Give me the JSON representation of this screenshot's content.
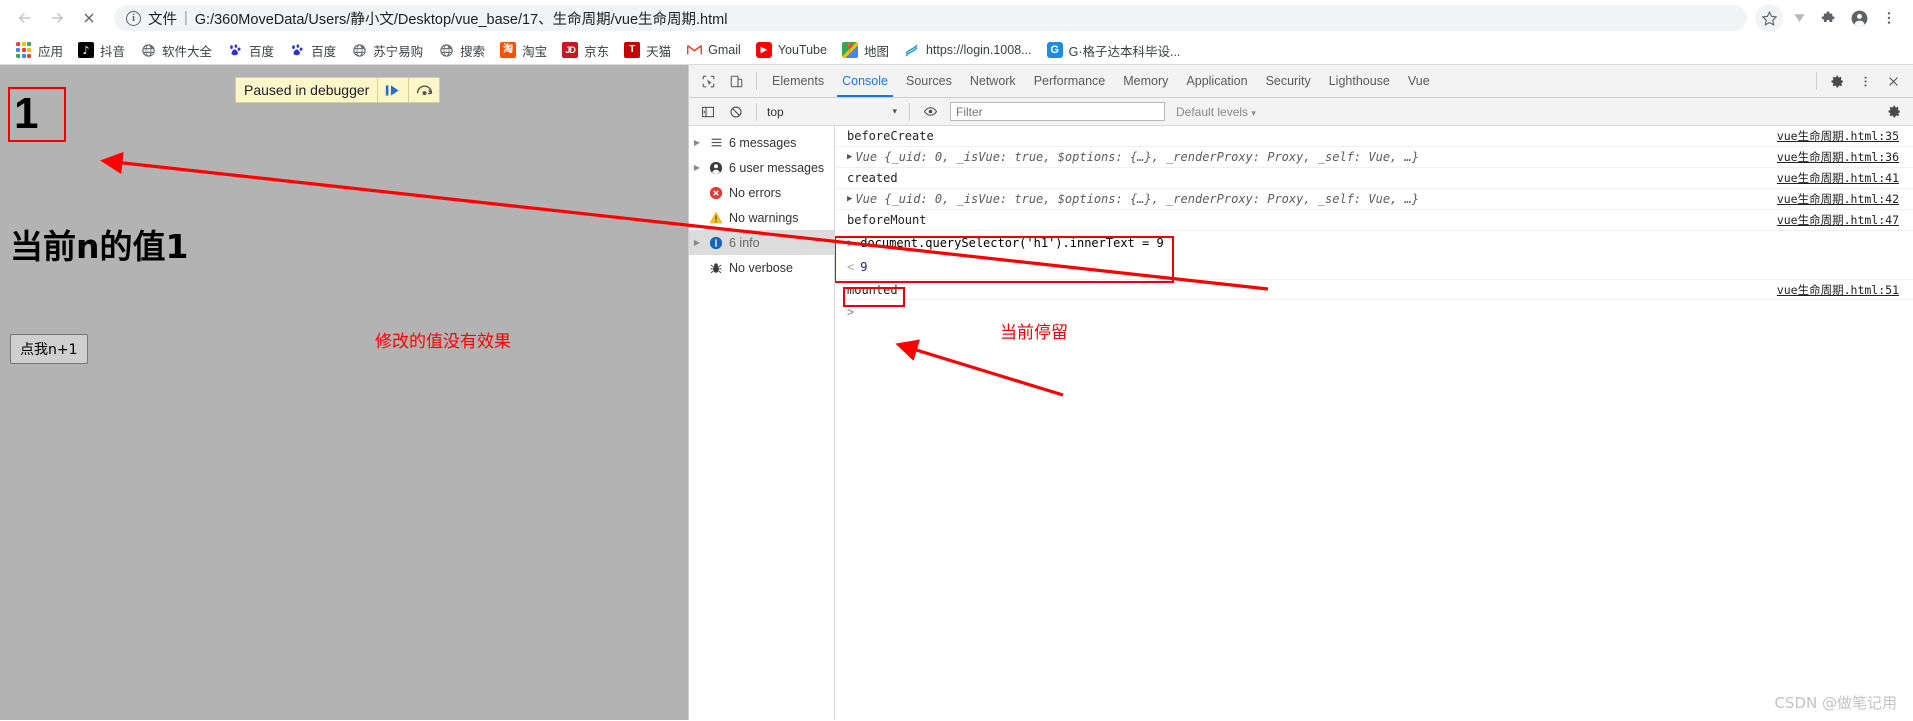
{
  "browser": {
    "nav": {
      "back_icon": "arrow-left-icon",
      "forward_icon": "arrow-right-icon",
      "stop_icon": "close-x-icon"
    },
    "omnibox": {
      "info_icon": "info-circle-icon",
      "scheme_label": "文件",
      "separator": "|",
      "url": "G:/360MoveData/Users/静小文/Desktop/vue_base/17、生命周期/vue生命周期.html"
    },
    "right_icons": [
      {
        "name": "bookmark-star-icon",
        "glyph": "☆"
      },
      {
        "name": "download-chevron-icon",
        "glyph": "▼"
      },
      {
        "name": "extensions-puzzle-icon",
        "glyph": "🧩"
      },
      {
        "name": "profile-avatar-icon",
        "glyph": "●"
      },
      {
        "name": "chrome-menu-icon",
        "glyph": "⋮"
      }
    ],
    "bookmarks": [
      {
        "label": "应用",
        "icon": "apps-grid-icon"
      },
      {
        "label": "抖音",
        "icon": "douyin-icon"
      },
      {
        "label": "软件大全",
        "icon": "globe-icon"
      },
      {
        "label": "百度",
        "icon": "baidu-paw-icon"
      },
      {
        "label": "百度",
        "icon": "baidu-paw-icon"
      },
      {
        "label": "苏宁易购",
        "icon": "globe-icon"
      },
      {
        "label": "搜索",
        "icon": "globe-icon"
      },
      {
        "label": "淘宝",
        "icon": "taobao-icon"
      },
      {
        "label": "京东",
        "icon": "jd-icon"
      },
      {
        "label": "天猫",
        "icon": "tmall-icon"
      },
      {
        "label": "Gmail",
        "icon": "gmail-icon"
      },
      {
        "label": "YouTube",
        "icon": "youtube-icon"
      },
      {
        "label": "地图",
        "icon": "google-maps-icon"
      },
      {
        "label": "https://login.1008...",
        "icon": "blue-swirl-icon"
      },
      {
        "label": "G·格子达本科毕设...",
        "icon": "gezida-icon"
      }
    ]
  },
  "page": {
    "paused_banner": {
      "text": "Paused in debugger",
      "resume_icon": "resume-script-icon",
      "step_icon": "step-over-icon"
    },
    "h1_value": "1",
    "h2_text": "当前n的值1",
    "button_label": "点我n+1",
    "annotation": "修改的值没有效果",
    "background_color": "#b3b3b3",
    "highlight_color": "#ee0000"
  },
  "devtools": {
    "left_icons": [
      {
        "name": "inspect-element-icon",
        "glyph": "⬚"
      },
      {
        "name": "device-toolbar-icon",
        "glyph": "▯"
      }
    ],
    "tabs": [
      {
        "label": "Elements",
        "active": false
      },
      {
        "label": "Console",
        "active": true
      },
      {
        "label": "Sources",
        "active": false
      },
      {
        "label": "Network",
        "active": false
      },
      {
        "label": "Performance",
        "active": false
      },
      {
        "label": "Memory",
        "active": false
      },
      {
        "label": "Application",
        "active": false
      },
      {
        "label": "Security",
        "active": false
      },
      {
        "label": "Lighthouse",
        "active": false
      },
      {
        "label": "Vue",
        "active": false
      }
    ],
    "right_icons": [
      {
        "name": "settings-gear-icon",
        "glyph": "⚙"
      },
      {
        "name": "devtools-menu-icon",
        "glyph": "⋮"
      },
      {
        "name": "devtools-close-icon",
        "glyph": "✕"
      }
    ],
    "filter_bar": {
      "sidebar_toggle_icon": "console-sidebar-toggle-icon",
      "clear_icon": "clear-console-icon",
      "context_value": "top",
      "context_caret": "▾",
      "eye_icon": "live-expression-eye-icon",
      "filter_placeholder": "Filter",
      "filter_value": "",
      "levels_label": "Default levels",
      "levels_caret": "▾",
      "settings_icon": "console-settings-gear-icon"
    },
    "sidebar": [
      {
        "label": "6 messages",
        "icon": "list-icon",
        "expandable": true,
        "selected": false
      },
      {
        "label": "6 user messages",
        "icon": "person-icon",
        "expandable": true,
        "selected": false
      },
      {
        "label": "No errors",
        "icon": "error-icon",
        "expandable": false,
        "selected": false
      },
      {
        "label": "No warnings",
        "icon": "warning-icon",
        "expandable": false,
        "selected": false
      },
      {
        "label": "6 info",
        "icon": "info-icon",
        "expandable": true,
        "selected": true
      },
      {
        "label": "No verbose",
        "icon": "bug-icon",
        "expandable": false,
        "selected": false
      }
    ],
    "messages": [
      {
        "type": "log",
        "text": "beforeCreate",
        "source": "vue生命周期.html:35"
      },
      {
        "type": "object",
        "text": "Vue {_uid: 0, _isVue: true, $options: {…}, _renderProxy: Proxy, _self: Vue, …}",
        "source": "vue生命周期.html:36"
      },
      {
        "type": "log",
        "text": "created",
        "source": "vue生命周期.html:41"
      },
      {
        "type": "object",
        "text": "Vue {_uid: 0, _isVue: true, $options: {…}, _renderProxy: Proxy, _self: Vue, …}",
        "source": "vue生命周期.html:42"
      },
      {
        "type": "log",
        "text": "beforeMount",
        "source": "vue生命周期.html:47"
      }
    ],
    "evaluation": {
      "input": "document.querySelector('h1').innerText = 9",
      "input_caret": ">",
      "result": "9",
      "result_caret": "<"
    },
    "after_eval_messages": [
      {
        "type": "log",
        "text": "mounted",
        "source": "vue生命周期.html:51"
      }
    ],
    "empty_prompt_caret": ">"
  },
  "annotations": {
    "page_note": "修改的值没有效果",
    "console_note": "当前停留",
    "arrow_color": "#ff0000"
  },
  "watermark": "CSDN @做笔记用"
}
